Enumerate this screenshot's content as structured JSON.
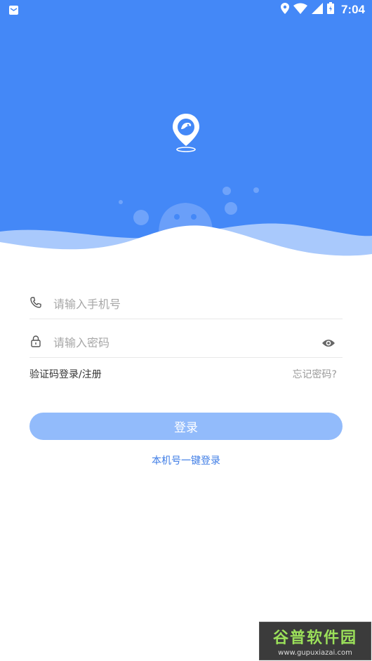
{
  "status_bar": {
    "time": "7:04",
    "icons": [
      "mail-icon",
      "location-icon",
      "wifi-icon",
      "signal-icon",
      "battery-icon"
    ]
  },
  "colors": {
    "hero_blue": "#4488f7",
    "button": "#92bbfb",
    "link_blue": "#3f7de6"
  },
  "form": {
    "phone_placeholder": "请输入手机号",
    "phone_value": "",
    "password_placeholder": "请输入密码",
    "password_value": ""
  },
  "links": {
    "sms_login": "验证码登录/注册",
    "forgot_password": "忘记密码?"
  },
  "login_button": "登录",
  "one_key_login": "本机号一键登录",
  "watermark": {
    "title": "谷普软件园",
    "url": "www.gupuxiazai.com"
  }
}
